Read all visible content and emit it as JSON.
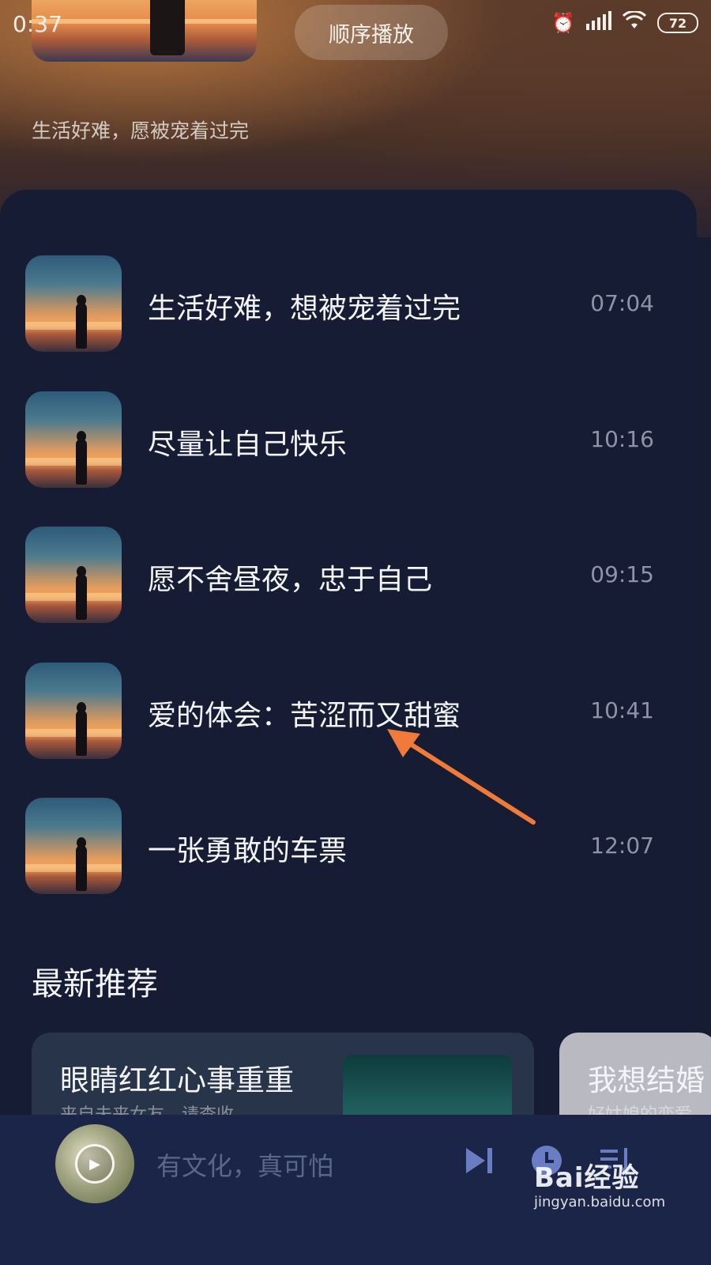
{
  "status_bar": {
    "time": "0:37",
    "battery": "72"
  },
  "header": {
    "play_mode": "顺序播放",
    "subtitle": "生活好难，愿被宠着过完"
  },
  "tracks": [
    {
      "title": "生活好难，想被宠着过完",
      "duration": "07:04"
    },
    {
      "title": "尽量让自己快乐",
      "duration": "10:16"
    },
    {
      "title": "愿不舍昼夜，忠于自己",
      "duration": "09:15"
    },
    {
      "title": "爱的体会：苦涩而又甜蜜",
      "duration": "10:41"
    },
    {
      "title": "一张勇敢的车票",
      "duration": "12:07"
    }
  ],
  "recommend": {
    "title": "最新推荐",
    "cards": [
      {
        "title": "眼睛红红心事重重",
        "subtitle": "来自未来女友，请查收"
      },
      {
        "title": "我想结婚",
        "subtitle": "好姑娘的恋爱"
      }
    ]
  },
  "player": {
    "now_playing": "有文化，真可怕"
  },
  "watermark": {
    "brand": "Bai经验",
    "url": "jingyan.baidu.com"
  },
  "colors": {
    "panel_bg": "#151c33",
    "player_bg": "#1a2548",
    "accent_icon": "#6a7cc4",
    "arrow": "#f07a3a"
  }
}
